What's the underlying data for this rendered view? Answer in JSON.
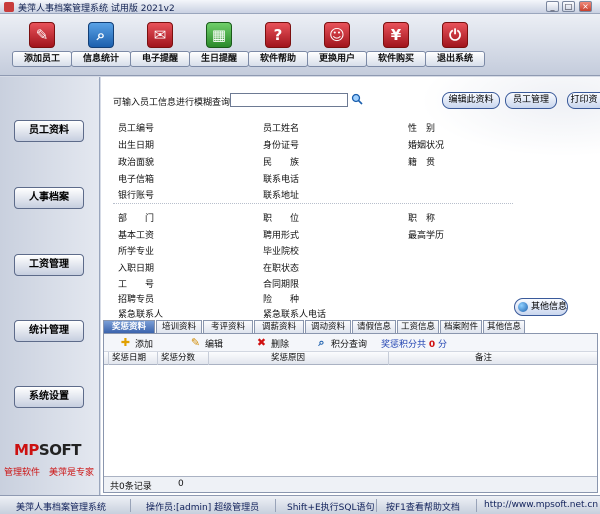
{
  "window": {
    "title": "美萍人事档案管理系统 试用版 2021v2",
    "controls": [
      "_",
      "□",
      "×"
    ]
  },
  "toolbar": {
    "buttons": [
      {
        "label": "添加员工",
        "icon": "add-employee-icon",
        "glyph": "✎"
      },
      {
        "label": "信息统计",
        "icon": "statistics-icon",
        "glyph": "⌕"
      },
      {
        "label": "电子提醒",
        "icon": "reminder-icon",
        "glyph": "✉"
      },
      {
        "label": "生日提醒",
        "icon": "birthday-calendar-icon",
        "glyph": "▦"
      },
      {
        "label": "软件帮助",
        "icon": "help-icon",
        "glyph": "?"
      },
      {
        "label": "更换用户",
        "icon": "switch-user-icon",
        "glyph": "☺"
      },
      {
        "label": "软件购买",
        "icon": "purchase-icon",
        "glyph": "¥"
      },
      {
        "label": "退出系统",
        "icon": "exit-icon",
        "glyph": "⏻"
      }
    ]
  },
  "sidebar": {
    "items": [
      "员工资料",
      "人事档案",
      "工资管理",
      "统计管理",
      "系统设置"
    ],
    "logo": {
      "mp": "MP",
      "rest": "SOFT"
    },
    "slogan": "管理软件　美萍是专家"
  },
  "search": {
    "label": "可输入员工信息进行模糊查询",
    "value": ""
  },
  "actions": {
    "edit": "编辑此资料",
    "employee": "员工管理",
    "print": "打印资"
  },
  "fields": {
    "row1": [
      "员工编号",
      "员工姓名",
      "性　别"
    ],
    "row2": [
      "出生日期",
      "身份证号",
      "婚姻状况"
    ],
    "row3": [
      "政治面貌",
      "民　　族",
      "籍　贯"
    ],
    "row4": [
      "电子信箱",
      "联系电话"
    ],
    "row5": [
      "银行账号",
      "联系地址"
    ],
    "row6": [
      "部　　门",
      "职　　位",
      "职　称"
    ],
    "row7": [
      "基本工资",
      "聘用形式",
      "最高学历"
    ],
    "row8": [
      "所学专业",
      "毕业院校"
    ],
    "row9": [
      "入职日期",
      "在职状态"
    ],
    "row10": [
      "工　　号",
      "合同期限"
    ],
    "row11": [
      "招聘专员",
      "险　　种"
    ],
    "row12": [
      "紧急联系人",
      "紧急联系人电话"
    ]
  },
  "other_info": "其他信息",
  "tabs": [
    "奖惩资料",
    "培训资料",
    "考评资料",
    "调薪资料",
    "调动资料",
    "请假信息",
    "工资信息",
    "档案附件",
    "其他信息"
  ],
  "tab_actions": {
    "add": "添加",
    "edit": "编辑",
    "delete": "删除",
    "score_query": "积分查询",
    "score_label": "奖惩积分共",
    "score_value": "0",
    "score_unit": "分"
  },
  "grid": {
    "columns": [
      "奖惩日期",
      "奖惩分数",
      "奖惩原因",
      "备注"
    ],
    "footer_label": "共0条记录",
    "footer_value": "0"
  },
  "statusbar": {
    "app": "美萍人事档案管理系统",
    "operator": "操作员:[admin] 超级管理员",
    "hint_sql": "Shift+E执行SQL语句",
    "hint_help": "按F1查看帮助文档",
    "url": "http://www.mpsoft.net.cn"
  },
  "colors": {
    "accent": "#3b64ad",
    "danger": "#cc1111",
    "score": "#d01010"
  }
}
